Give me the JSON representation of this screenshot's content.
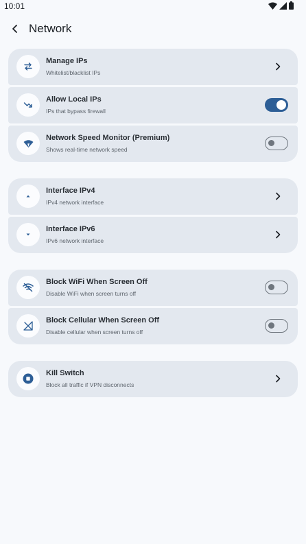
{
  "status_bar": {
    "time": "10:01"
  },
  "header": {
    "title": "Network"
  },
  "groups": [
    {
      "items": [
        {
          "title": "Manage IPs",
          "subtitle": "Whitelist/blacklist IPs",
          "icon": "swap-arrows-icon",
          "trailing": "chevron"
        },
        {
          "title": "Allow Local IPs",
          "subtitle": "IPs that bypass firewall",
          "icon": "trend-down-icon",
          "trailing": "switch",
          "enabled": true
        },
        {
          "title": "Network Speed Monitor (Premium)",
          "subtitle": "Shows real-time network speed",
          "icon": "wifi-speed-icon",
          "trailing": "switch",
          "enabled": false
        }
      ]
    },
    {
      "items": [
        {
          "title": "Interface IPv4",
          "subtitle": "IPv4 network interface",
          "icon": "arrow-up-icon",
          "trailing": "chevron"
        },
        {
          "title": "Interface IPv6",
          "subtitle": "IPv6 network interface",
          "icon": "arrow-down-icon",
          "trailing": "chevron"
        }
      ]
    },
    {
      "items": [
        {
          "title": "Block WiFi When Screen Off",
          "subtitle": "Disable WiFi when screen turns off",
          "icon": "wifi-off-icon",
          "trailing": "switch",
          "enabled": false
        },
        {
          "title": "Block Cellular When Screen Off",
          "subtitle": "Disable cellular when screen turns off",
          "icon": "cellular-off-icon",
          "trailing": "switch",
          "enabled": false
        }
      ]
    },
    {
      "items": [
        {
          "title": "Kill Switch",
          "subtitle": "Block all traffic if VPN disconnects",
          "icon": "stop-circle-icon",
          "trailing": "chevron"
        }
      ]
    }
  ],
  "colors": {
    "accent": "#2d5e96",
    "card": "#e3e8ef",
    "background": "#f7f9fc"
  }
}
